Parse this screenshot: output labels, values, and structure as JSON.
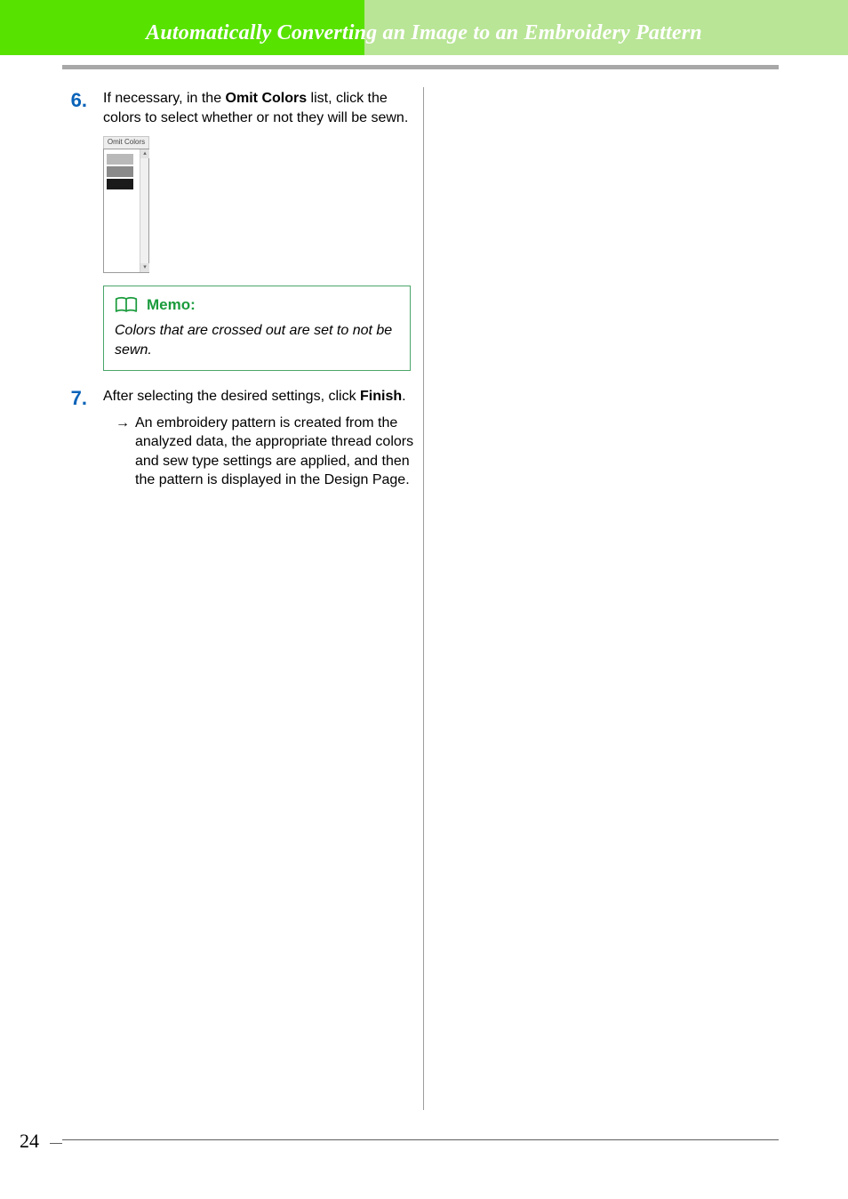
{
  "header": {
    "title": "Automatically Converting an Image to an Embroidery Pattern"
  },
  "steps": [
    {
      "num": "6.",
      "text_before": "If necessary, in the ",
      "bold1": "Omit Colors",
      "text_after": " list, click the colors to select whether or not they will be sewn."
    },
    {
      "num": "7.",
      "text_before": "After selecting the desired settings, click ",
      "bold1": "Finish",
      "text_after": "."
    }
  ],
  "omit_panel": {
    "label": "Omit Colors",
    "swatches": [
      "#b9b9b9",
      "#8a8a8a",
      "#1a1a1a"
    ]
  },
  "memo": {
    "title": "Memo:",
    "body": "Colors that are crossed out are set to not be sewn."
  },
  "result": {
    "arrow": "→",
    "text": "An embroidery pattern is created from the analyzed data, the appropriate thread colors and sew type settings are applied, and then the pattern is displayed in the Design Page."
  },
  "footer": {
    "page_number": "24"
  }
}
